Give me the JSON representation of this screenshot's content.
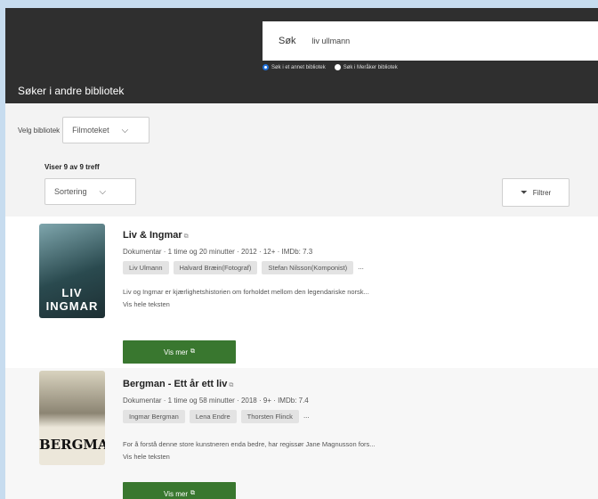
{
  "search": {
    "label": "Søk",
    "value": "liv ullmann"
  },
  "radios": [
    {
      "label": "Søk i et annet bibliotek",
      "selected": true
    },
    {
      "label": "Søk i Meråker bibliotek",
      "selected": false
    }
  ],
  "section_title": "Søker i andre bibliotek",
  "filters": {
    "library_label": "Velg bibliotek",
    "library_value": "Filmoteket",
    "count_text": "Viser 9 av 9 treff",
    "sort_value": "Sortering",
    "filter_label": "Filtrer"
  },
  "results": [
    {
      "title": "Liv & Ingmar",
      "meta": "Dokumentar · 1 time og 20 minutter · 2012 · 12+ · IMDb: 7.3",
      "chips": [
        "Liv Ulmann",
        "Halvard Bræin(Fotograf)",
        "Stefan Nilsson(Komponist)"
      ],
      "more_chips": "...",
      "description": "Liv og Ingmar er kjærlighetshistorien om forholdet mellom den legendariske norsk...",
      "show_text": "Vis hele teksten",
      "button": "Vis mer",
      "poster_text": "LIV INGMAR",
      "poster_color": "#2a4a4f"
    },
    {
      "title": "Bergman - Ett år ett liv",
      "meta": "Dokumentar · 1 time og 58 minutter · 2018 · 9+ · IMDb: 7.4",
      "chips": [
        "Ingmar Bergman",
        "Lena Endre",
        "Thorsten Flinck"
      ],
      "more_chips": "...",
      "description": "For å forstå denne store kunstneren enda bedre, har regissør Jane Magnusson fors...",
      "show_text": "Vis hele teksten",
      "button": "Vis mer",
      "poster_text": "BERGMAN",
      "poster_color": "#e9e4d6"
    }
  ],
  "colors": {
    "topbar": "#2f2f2f",
    "button": "#39772f",
    "background": "#c7dcef"
  }
}
